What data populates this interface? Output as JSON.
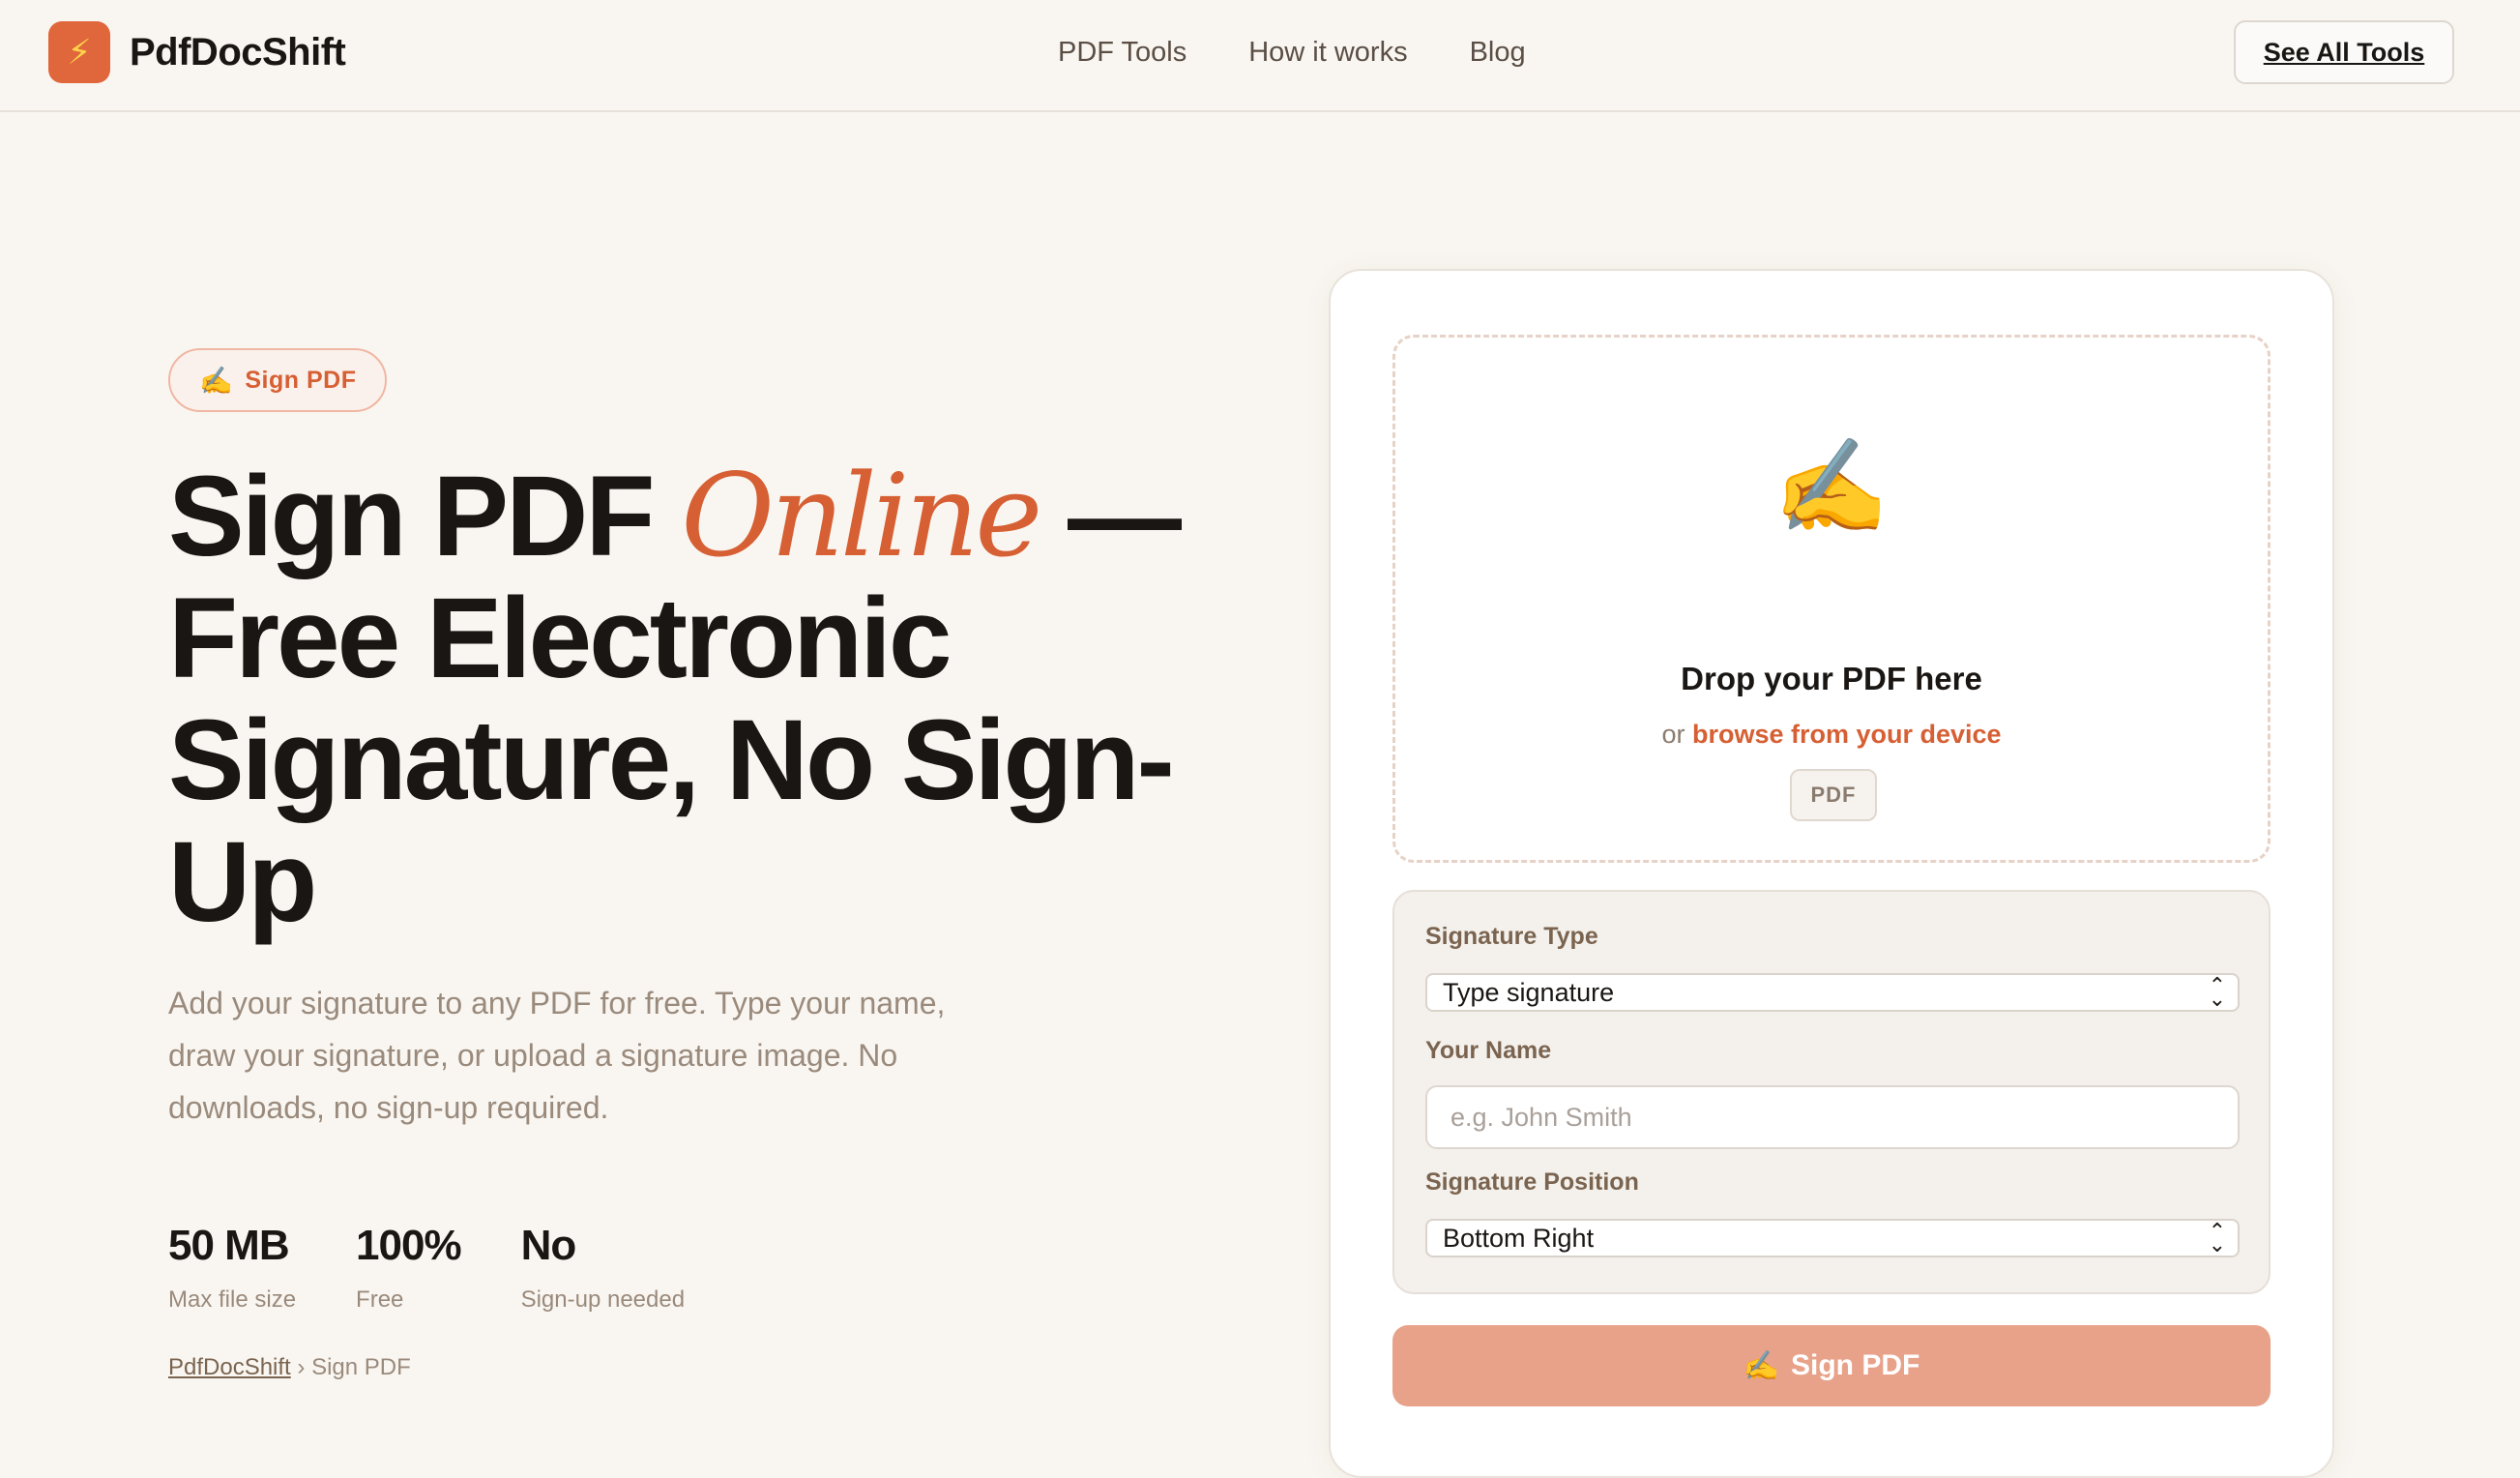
{
  "brand": {
    "name": "PdfDocShift",
    "icon": "lightning-icon",
    "accent": "#e0663c"
  },
  "nav": {
    "items": [
      "PDF Tools",
      "How it works",
      "Blog"
    ],
    "cta": "See All Tools"
  },
  "hero": {
    "badge_icon": "✍️",
    "badge_label": "Sign PDF",
    "title_part1": "Sign PDF ",
    "title_accent": "Online",
    "title_part2": " — Free Electronic Signature, No Sign-Up",
    "description": "Add your signature to any PDF for free. Type your name, draw your signature, or upload a signature image. No downloads, no sign-up required.",
    "stats": [
      {
        "value": "50 MB",
        "label": "Max file size"
      },
      {
        "value": "100%",
        "label": "Free"
      },
      {
        "value": "No",
        "label": "Sign-up needed"
      }
    ],
    "breadcrumb": {
      "home": "PdfDocShift",
      "separator": "›",
      "current": "Sign PDF"
    }
  },
  "upload": {
    "icon": "✍️",
    "title": "Drop your PDF here",
    "sub_prefix": "or ",
    "browse_label": "browse from your device",
    "format_chip": "PDF"
  },
  "options": {
    "signature_type_label": "Signature Type",
    "signature_type_value": "Type signature",
    "name_label": "Your Name",
    "name_placeholder": "e.g. John Smith",
    "name_value": "",
    "position_label": "Signature Position",
    "position_value": "Bottom Right"
  },
  "submit": {
    "icon": "✍️",
    "label": "Sign PDF"
  }
}
